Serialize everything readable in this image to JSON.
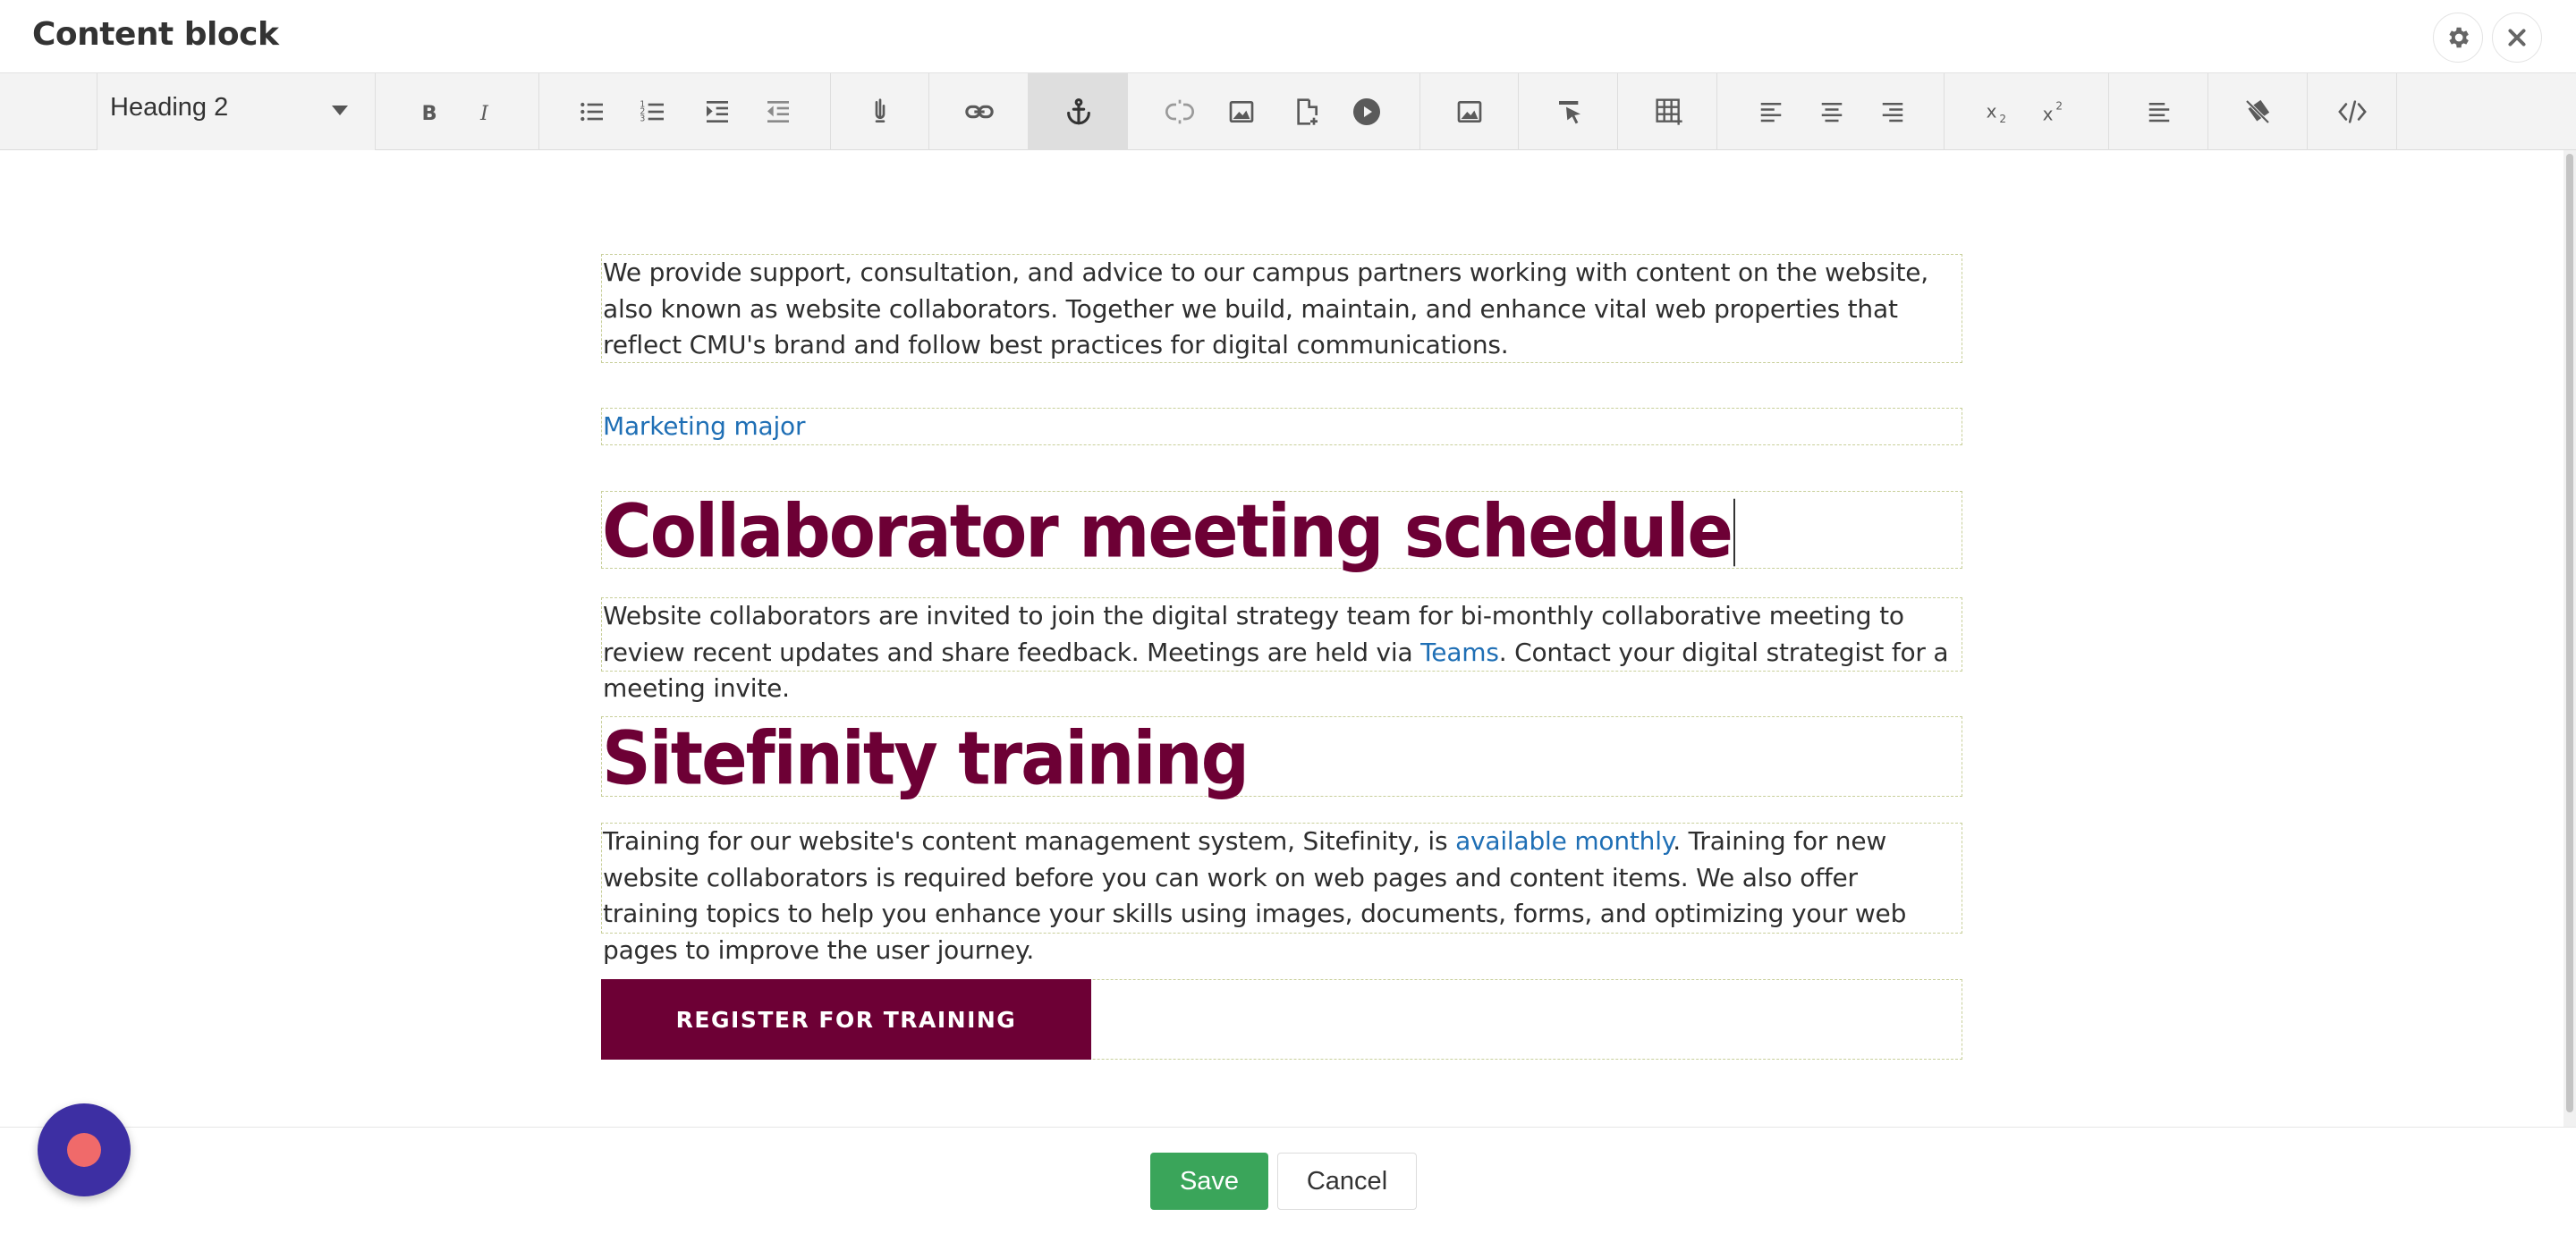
{
  "window": {
    "title": "Content block"
  },
  "toolbar": {
    "format_select": {
      "selected": "Heading 2"
    },
    "buttons": [
      "bold-icon",
      "italic-icon",
      "bullet-list-icon",
      "numbered-list-icon",
      "indent-icon",
      "outdent-icon",
      "paste-plain-icon",
      "link-icon",
      "anchor-icon",
      "unlink-icon",
      "image-icon",
      "document-icon",
      "video-icon",
      "image-manager-icon",
      "format-painter-icon",
      "table-icon",
      "align-left-icon",
      "align-center-icon",
      "align-right-icon",
      "subscript-icon",
      "superscript-icon",
      "paragraph-style-icon",
      "clear-format-icon",
      "html-source-icon"
    ],
    "active_button": "anchor-icon"
  },
  "content": {
    "intro": "We provide support, consultation, and advice to our campus partners working with content on the website, also known as website collaborators. Together we build, maintain, and enhance vital web properties that reflect CMU's brand and follow best practices for digital communications.",
    "marketing_link": "Marketing major",
    "heading1": "Collaborator meeting schedule",
    "meeting_para_before": "Website collaborators are invited to join the digital strategy team for bi-monthly collaborative meeting to review recent updates and share feedback. Meetings are held via ",
    "meeting_link": "Teams",
    "meeting_para_after": ". Contact your digital strategist for a meeting invite.",
    "heading2": "Sitefinity training",
    "training_para_before": "Training for our website's content management system, Sitefinity, is ",
    "training_link": "available monthly",
    "training_para_after": ". Training for new website collaborators is required before you can work on web pages and content items. We also offer training topics to help you enhance your skills using images, documents, forms, and optimizing your web pages to improve the user journey.",
    "cta_label": "REGISTER FOR TRAINING"
  },
  "footer": {
    "save_label": "Save",
    "cancel_label": "Cancel"
  },
  "colors": {
    "heading": "#6d0035",
    "link": "#1f6fb5",
    "save": "#3aa55a",
    "fab": "#3d2fa3",
    "fab_dot": "#f06a6a"
  }
}
